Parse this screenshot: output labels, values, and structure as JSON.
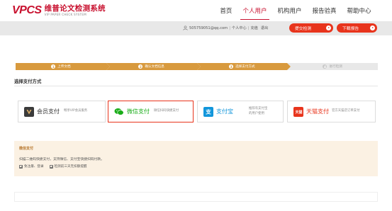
{
  "header": {
    "logo": {
      "mark": "VPCS",
      "title": "维普论文检测系统",
      "subtitle": "VIP PAPER CHECK SYSTEM"
    },
    "nav": [
      {
        "label": "首页",
        "active": false
      },
      {
        "label": "个人用户",
        "active": true
      },
      {
        "label": "机构用户",
        "active": false
      },
      {
        "label": "报告验真",
        "active": false
      },
      {
        "label": "帮助中心",
        "active": false
      }
    ]
  },
  "subbar": {
    "user_email": "505759051@qq.com",
    "personal_center": "个人中心",
    "recharge": "充值",
    "logout": "退出",
    "submit_button": "提交检测",
    "download_button": "下载报告"
  },
  "steps": [
    {
      "num": "1",
      "label": "上传文档",
      "state": "done"
    },
    {
      "num": "2",
      "label": "确认文档信息",
      "state": "done"
    },
    {
      "num": "3",
      "label": "选择支付方式",
      "state": "done"
    },
    {
      "num": "4",
      "label": "进行检测",
      "state": "todo"
    }
  ],
  "section_title": "选择支付方式",
  "payment_methods": [
    {
      "name": "会员支付",
      "desc": "畅享VIP会员服务",
      "icon": "vip-icon",
      "color": "#3b3b3b",
      "selected": false
    },
    {
      "name": "微信支付",
      "desc": "微信扫码快捷支付",
      "icon": "wechat-icon",
      "color": "#1aad19",
      "selected": true
    },
    {
      "name": "支付宝",
      "desc": "推荐有支付宝\n的用户使用",
      "icon": "alipay-icon",
      "color": "#1296db",
      "selected": false
    },
    {
      "name": "天猫支付",
      "desc": "官方天猫店订单支付",
      "icon": "tmall-icon",
      "color": "#e8341c",
      "selected": false
    }
  ],
  "info": {
    "title": "微信支付",
    "text": "扫描二维码快捷支付，支持微信、支付宝快捷扫码付款。",
    "checks": [
      "免注册、登录",
      "检测前三天无扣额提醒"
    ]
  },
  "colors": {
    "brand_red": "#c8102e",
    "button_red": "#e8341c",
    "step_gold": "#d89a3e",
    "info_bg": "#fbf1e3"
  }
}
